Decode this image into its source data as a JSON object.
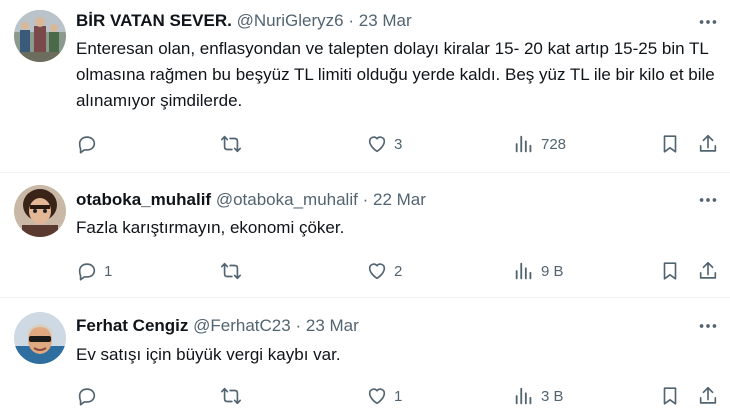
{
  "tweets": [
    {
      "name": "BİR VATAN SEVER.",
      "handle": "@NuriGleryz6",
      "sep": "·",
      "date": "23 Mar",
      "text": "Enteresan olan, enflasyondan ve talepten dolayı kiralar 15- 20 kat artıp 15-25 bin TL olmasına rağmen bu beşyüz TL limiti olduğu yerde kaldı. Beş yüz TL ile bir kilo et bile alınamıyor şimdilerde.",
      "replies": "",
      "retweets": "",
      "likes": "3",
      "views": "728"
    },
    {
      "name": "otaboka_muhalif",
      "handle": "@otaboka_muhalif",
      "sep": "·",
      "date": "22 Mar",
      "text": "Fazla karıştırmayın, ekonomi çöker.",
      "replies": "1",
      "retweets": "",
      "likes": "2",
      "views": "9 B"
    },
    {
      "name": "Ferhat Cengiz",
      "handle": "@FerhatC23",
      "sep": "·",
      "date": "23 Mar",
      "text": "Ev satışı için büyük vergi kaybı var.",
      "replies": "",
      "retweets": "",
      "likes": "1",
      "views": "3 B"
    }
  ],
  "icons": {
    "reply": "reply-icon",
    "retweet": "retweet-icon",
    "like": "heart-icon",
    "views": "views-icon",
    "bookmark": "bookmark-icon",
    "share": "share-icon",
    "more": "more-icon"
  },
  "colors": {
    "text": "#0f1419",
    "secondary": "#536471",
    "divider": "#eff3f4"
  }
}
